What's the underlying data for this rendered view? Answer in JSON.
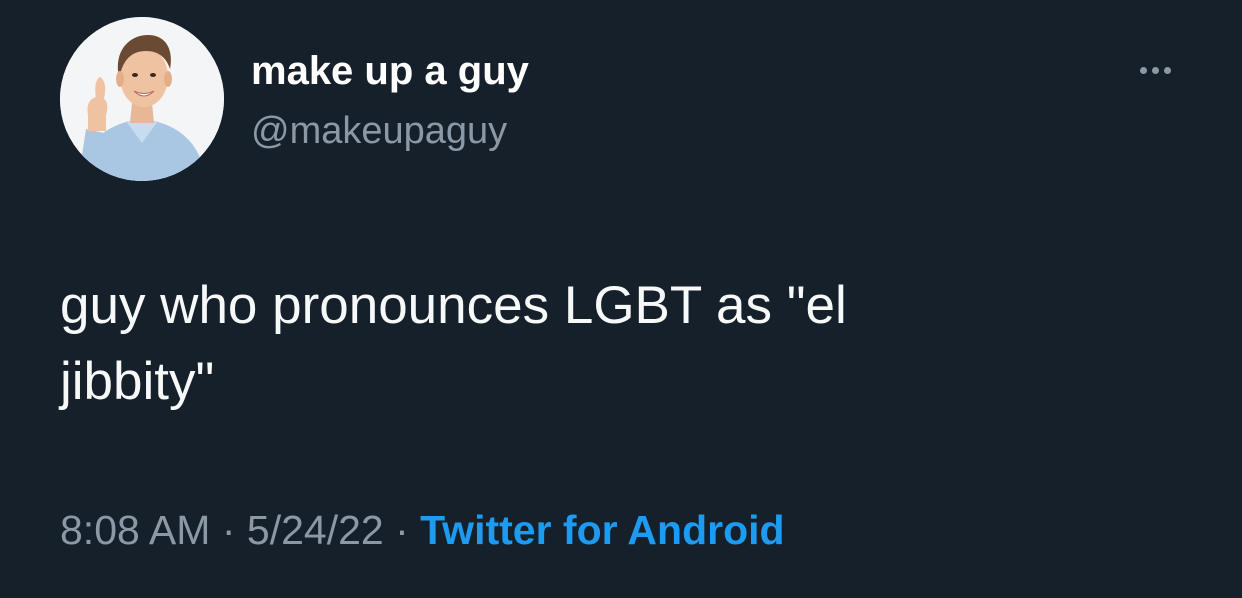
{
  "user": {
    "display_name": "make up a guy",
    "handle": "@makeupaguy",
    "avatar_icon": "profile-photo-thumbs-up-man"
  },
  "more_icon": "more-horizontal-icon",
  "tweet": {
    "text": "guy who pronounces LGBT as \"el\njibbity\""
  },
  "meta": {
    "time": "8:08 AM",
    "separator": "·",
    "date": "5/24/22",
    "source": "Twitter for Android"
  },
  "colors": {
    "background": "#15202b",
    "primary_text": "#f7f9f9",
    "secondary_text": "#8b98a5",
    "accent": "#1d9bf0"
  }
}
